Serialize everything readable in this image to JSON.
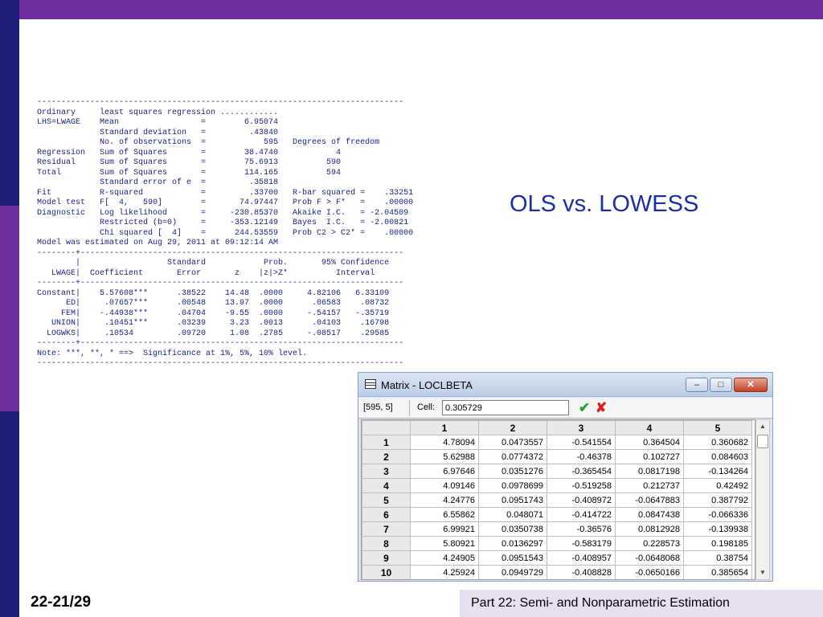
{
  "slide": {
    "title": "OLS vs. LOWESS",
    "page_number": "22-21/29",
    "footer": "Part 22: Semi- and Nonparametric Estimation",
    "colors": {
      "accent_purple": "#7030a0",
      "accent_navy": "#1f1f7a",
      "title_blue": "#1a2ea8",
      "output_text": "#1a237e"
    }
  },
  "regression_output": "----------------------------------------------------------------------------\nOrdinary     least squares regression ............\nLHS=LWAGE    Mean                 =        6.95074\n             Standard deviation   =         .43840\n             No. of observations  =            595   Degrees of freedom\nRegression   Sum of Squares       =        38.4740            4\nResidual     Sum of Squares       =        75.6913          590\nTotal        Sum of Squares       =        114.165          594\n             Standard error of e  =         .35818\nFit          R-squared            =         .33700   R-bar squared =    .33251\nModel test   F[  4,   590]        =       74.97447   Prob F > F*   =    .00000\nDiagnostic   Log likelihood       =     -230.85370   Akaike I.C.   = -2.04509\n             Restricted (b=0)     =     -353.12149   Bayes  I.C.   = -2.00821\n             Chi squared [  4]    =      244.53559   Prob C2 > C2* =    .00000\nModel was estimated on Aug 29, 2011 at 09:12:14 AM\n--------+-------------------------------------------------------------------\n        |                  Standard            Prob.       95% Confidence\n   LWAGE|  Coefficient       Error       z    |z|>Z*          Interval\n--------+-------------------------------------------------------------------\nConstant|    5.57608***      .38522    14.48  .0000     4.82106   6.33109\n      ED|     .07657***      .00548    13.97  .0000      .06583    .08732\n     FEM|    -.44938***      .04704    -9.55  .0000     -.54157   -.35719\n   UNION|     .10451***      .03239     3.23  .0013      .04103    .16798\n  LOGWKS|     .10534         .09720     1.08  .2785     -.08517    .29585\n--------+-------------------------------------------------------------------\nNote: ***, **, * ==>  Significance at 1%, 5%, 10% level.\n----------------------------------------------------------------------------",
  "matrix_window": {
    "title": "Matrix - LOCLBETA",
    "buttons": {
      "minimize_icon": "minimize-icon",
      "maximize_icon": "maximize-icon",
      "close_icon": "close-icon"
    },
    "cell_ref": "[595, 5]",
    "cell_label": "Cell:",
    "cell_value": "0.305729",
    "columns": [
      "1",
      "2",
      "3",
      "4",
      "5"
    ],
    "rows": [
      {
        "label": "1",
        "values": [
          "4.78094",
          "0.0473557",
          "-0.541554",
          "0.364504",
          "0.360682"
        ]
      },
      {
        "label": "2",
        "values": [
          "5.62988",
          "0.0774372",
          "-0.46378",
          "0.102727",
          "0.084603"
        ]
      },
      {
        "label": "3",
        "values": [
          "6.97646",
          "0.0351276",
          "-0.365454",
          "0.0817198",
          "-0.134264"
        ]
      },
      {
        "label": "4",
        "values": [
          "4.09146",
          "0.0978699",
          "-0.519258",
          "0.212737",
          "0.42492"
        ]
      },
      {
        "label": "5",
        "values": [
          "4.24776",
          "0.0951743",
          "-0.408972",
          "-0.0647883",
          "0.387792"
        ]
      },
      {
        "label": "6",
        "values": [
          "6.55862",
          "0.048071",
          "-0.414722",
          "0.0847438",
          "-0.066336"
        ]
      },
      {
        "label": "7",
        "values": [
          "6.99921",
          "0.0350738",
          "-0.36576",
          "0.0812928",
          "-0.139938"
        ]
      },
      {
        "label": "8",
        "values": [
          "5.80921",
          "0.0136297",
          "-0.583179",
          "0.228573",
          "0.198185"
        ]
      },
      {
        "label": "9",
        "values": [
          "4.24905",
          "0.0951543",
          "-0.408957",
          "-0.0648068",
          "0.38754"
        ]
      },
      {
        "label": "10",
        "values": [
          "4.25924",
          "0.0949729",
          "-0.408828",
          "-0.0650166",
          "0.385654"
        ]
      }
    ]
  }
}
